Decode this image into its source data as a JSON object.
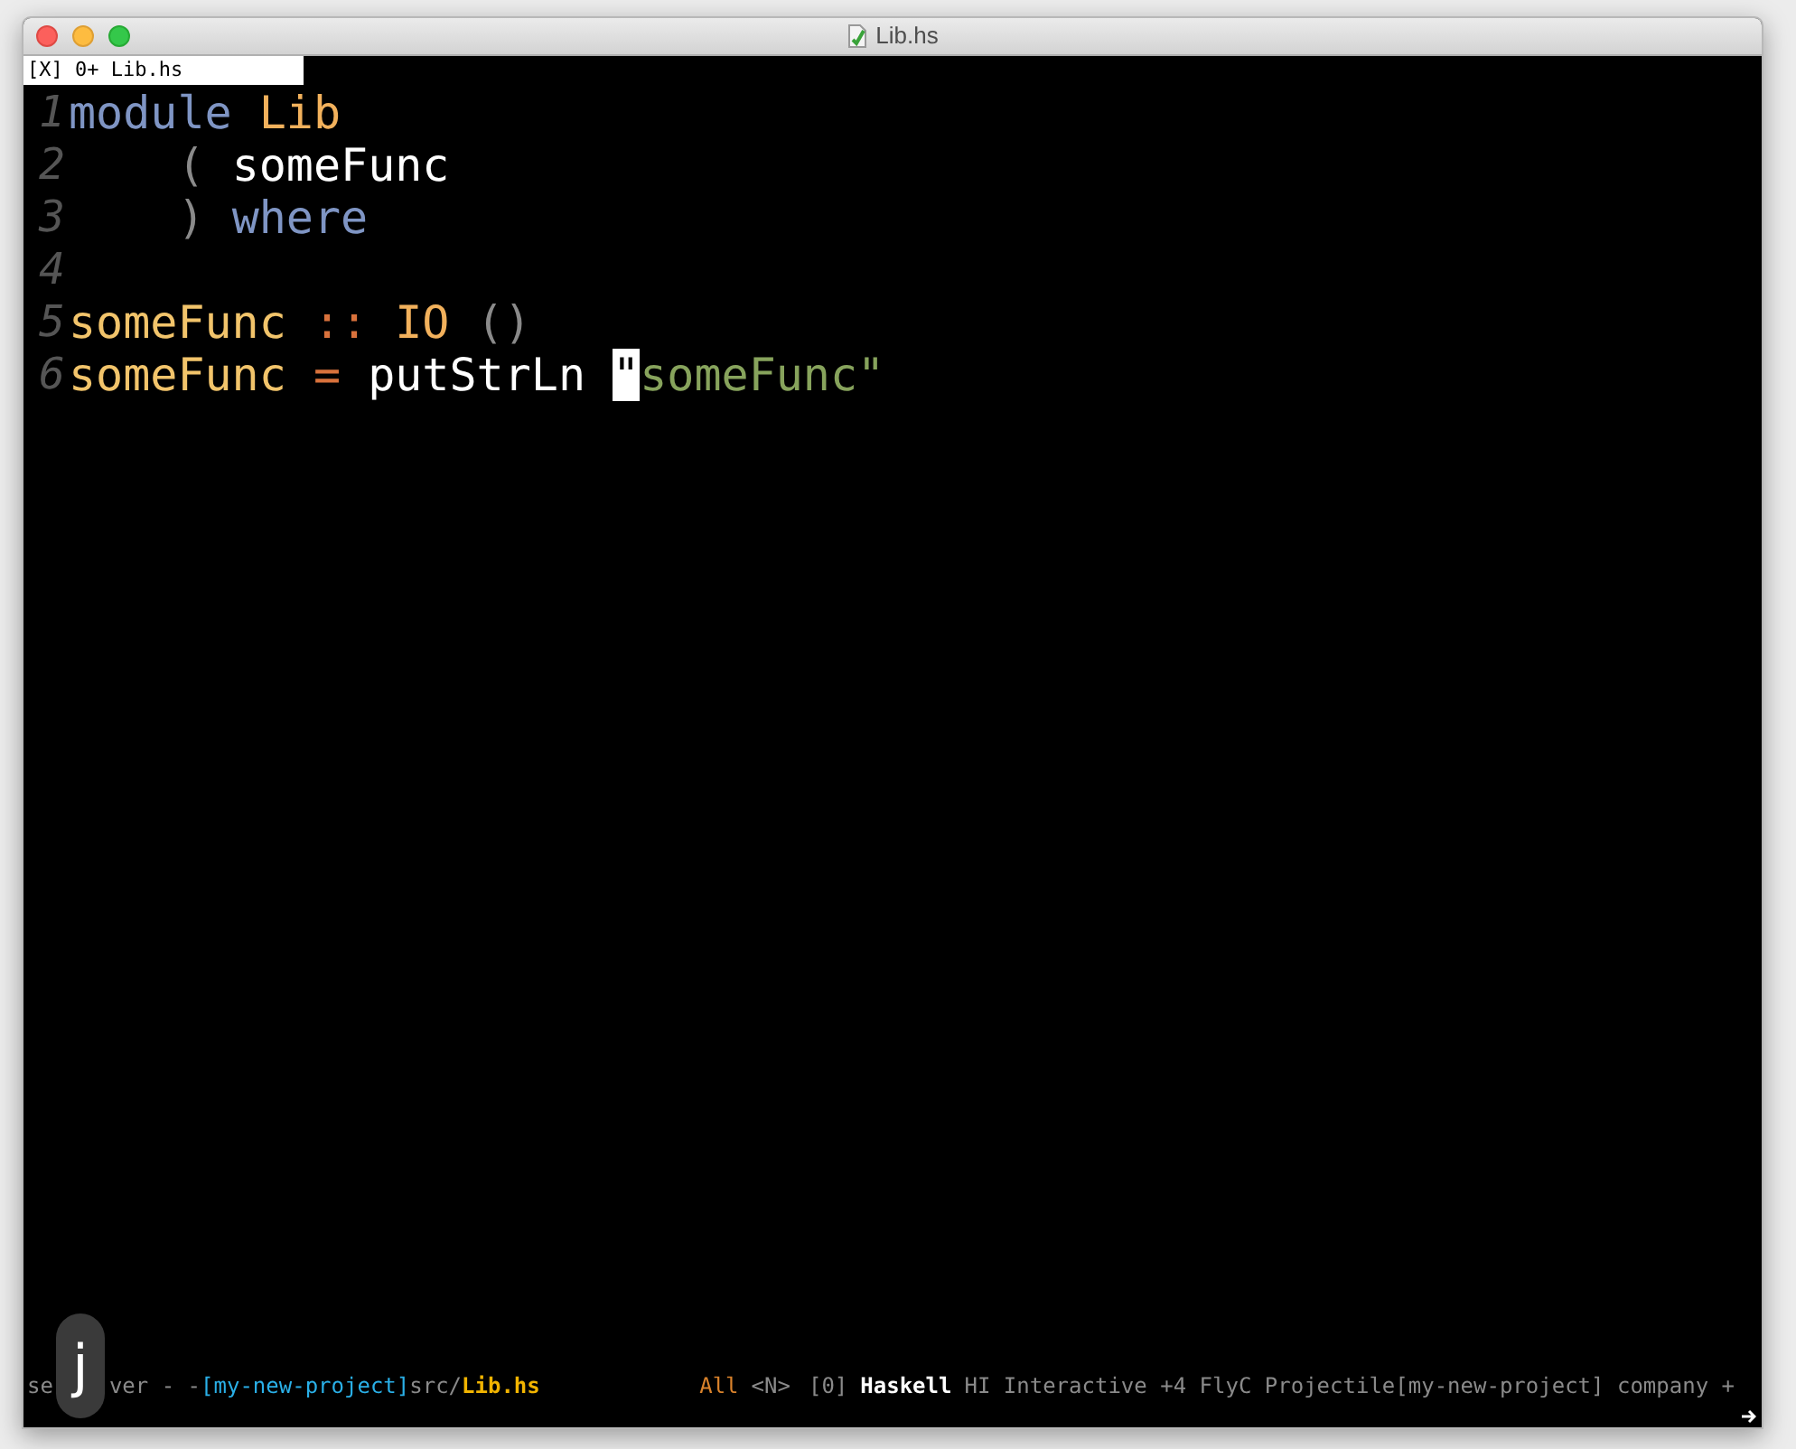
{
  "window": {
    "title": "Lib.hs"
  },
  "tab_line": {
    "label": "[X] 0+ Lib.hs"
  },
  "lines": [
    {
      "number": "1",
      "tokens": [
        {
          "text": "module",
          "kind": "keyword"
        },
        {
          "text": " Lib",
          "kind": "type"
        }
      ]
    },
    {
      "number": "2",
      "tokens": [
        {
          "text": "    (",
          "kind": "paren"
        },
        {
          "text": " someFunc",
          "kind": "plain"
        }
      ]
    },
    {
      "number": "3",
      "tokens": [
        {
          "text": "    )",
          "kind": "paren"
        },
        {
          "text": " where",
          "kind": "keyword"
        }
      ]
    },
    {
      "number": "4"
    },
    {
      "number": "5",
      "tokens": [
        {
          "text": "someFunc",
          "kind": "function"
        },
        {
          "text": " ::",
          "kind": "operator"
        },
        {
          "text": " IO",
          "kind": "type"
        },
        {
          "text": " ()",
          "kind": "paren"
        }
      ]
    },
    {
      "number": "6",
      "tokens": [
        {
          "text": "someFunc",
          "kind": "function"
        },
        {
          "text": " =",
          "kind": "operator"
        },
        {
          "text": " putStrLn ",
          "kind": "plain"
        },
        {
          "text": "\"",
          "kind": "cursor"
        },
        {
          "text": "someFunc\"",
          "kind": "string"
        }
      ]
    }
  ],
  "mode_line": {
    "left": [
      {
        "text": "se",
        "kind": "dim"
      },
      {
        "text": "ver - -",
        "kind": "dim"
      },
      {
        "text": "[my-new-project]",
        "kind": "project"
      },
      {
        "text": "src/",
        "kind": "dim"
      },
      {
        "text": "Lib.hs",
        "kind": "file"
      }
    ],
    "right": [
      {
        "text": "All",
        "kind": "position"
      },
      {
        "text": "<N>",
        "kind": "dim"
      },
      {
        "text": "[0]",
        "kind": "dim"
      },
      {
        "text": "Haskell",
        "kind": "major"
      },
      {
        "text": "HI Interactive +4 FlyC Projectile[my-new-project] company +",
        "kind": "dim"
      }
    ]
  },
  "keystroke": {
    "key": "j"
  }
}
